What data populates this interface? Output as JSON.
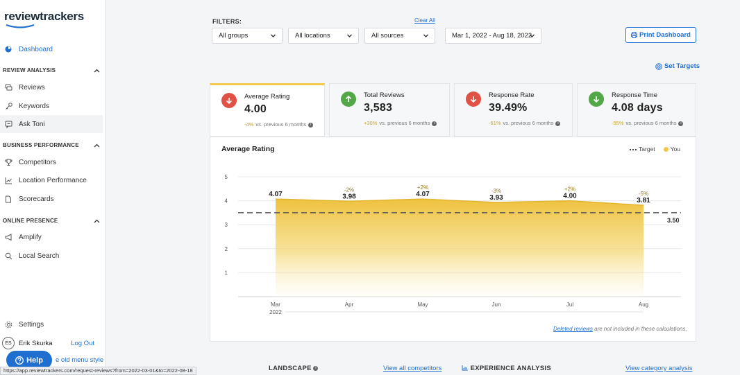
{
  "logo": {
    "text": "reviewtrackers"
  },
  "sidebar": {
    "dashboard": "Dashboard",
    "sections": [
      {
        "title": "REVIEW ANALYSIS",
        "items": [
          "Reviews",
          "Keywords",
          "Ask Toni"
        ]
      },
      {
        "title": "BUSINESS PERFORMANCE",
        "items": [
          "Competitors",
          "Location Performance",
          "Scorecards"
        ]
      },
      {
        "title": "ONLINE PRESENCE",
        "items": [
          "Amplify",
          "Local Search"
        ]
      }
    ],
    "settings": "Settings",
    "user_initials": "ES",
    "user_name": "Erik Skurka",
    "logout": "Log Out",
    "help": "Help",
    "old_menu": "e old menu style",
    "status_url": "https://app.reviewtrackers.com/request-reviews?from=2022-03-01&to=2022-08-18"
  },
  "filters": {
    "label": "FILTERS:",
    "clear_all": "Clear All",
    "groups": "All groups",
    "locations": "All locations",
    "sources": "All sources",
    "date_range": "Mar 1, 2022 - Aug 18, 2022"
  },
  "print_dashboard": "Print Dashboard",
  "set_targets": "Set Targets",
  "kpis": [
    {
      "label": "Average Rating",
      "value": "4.00",
      "delta": "-4%",
      "compare": "vs. previous 6 months",
      "trend": "down"
    },
    {
      "label": "Total Reviews",
      "value": "3,583",
      "delta": "+30%",
      "compare": "vs. previous 6 months",
      "trend": "up"
    },
    {
      "label": "Response Rate",
      "value": "39.49%",
      "delta": "-61%",
      "compare": "vs. previous 6 months",
      "trend": "down"
    },
    {
      "label": "Response Time",
      "value": "4.08 days",
      "delta": "-55%",
      "compare": "vs. previous 6 months",
      "trend": "up"
    }
  ],
  "chart": {
    "title": "Average Rating",
    "legend_target": "Target",
    "legend_you": "You",
    "year_label": "2022",
    "footnote_link": "Deleted reviews",
    "footnote_text": " are not included in these calculations."
  },
  "chart_data": {
    "type": "area",
    "title": "Average Rating",
    "categories": [
      "Mar",
      "Apr",
      "May",
      "Jun",
      "Jul",
      "Aug"
    ],
    "series": [
      {
        "name": "You",
        "values": [
          4.07,
          3.98,
          4.07,
          3.93,
          4.0,
          3.81
        ]
      },
      {
        "name": "Target",
        "values": [
          3.5,
          3.5,
          3.5,
          3.5,
          3.5,
          3.5
        ]
      }
    ],
    "change_labels": [
      "",
      "-2%",
      "+2%",
      "-3%",
      "+2%",
      "-5%"
    ],
    "target_value": "3.50",
    "ylim": [
      0,
      5
    ],
    "yticks": [
      1,
      2,
      3,
      4,
      5
    ],
    "grid": true,
    "legend_position": "top-right"
  },
  "bottom": {
    "landscape": "LANDSCAPE",
    "view_competitors": "View all competitors",
    "experience": "EXPERIENCE ANALYSIS",
    "view_category": "View category analysis"
  },
  "colors": {
    "accent": "#1f6fd1",
    "gold": "#f2c94c",
    "down": "#e05245",
    "up": "#52a746"
  }
}
